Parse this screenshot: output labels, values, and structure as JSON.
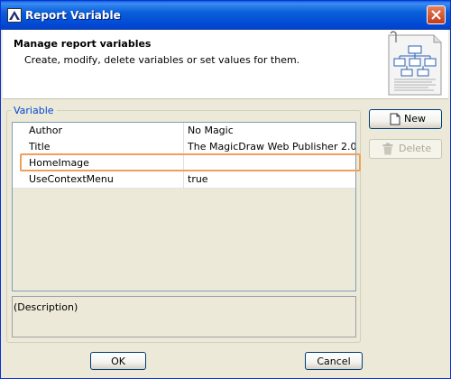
{
  "window": {
    "title": "Report Variable"
  },
  "header": {
    "title": "Manage report variables",
    "description": "Create, modify, delete variables or set values for them."
  },
  "group": {
    "label": "Variable"
  },
  "table": {
    "rows": [
      {
        "name": "Author",
        "value": "No Magic"
      },
      {
        "name": "Title",
        "value": "The MagicDraw Web Publisher 2.0"
      },
      {
        "name": "HomeImage",
        "value": ""
      },
      {
        "name": "UseContextMenu",
        "value": "true"
      }
    ]
  },
  "description_panel": {
    "text": "(Description)"
  },
  "buttons": {
    "new": "New",
    "delete": "Delete",
    "ok": "OK",
    "cancel": "Cancel"
  },
  "colors": {
    "highlight": "#f0a05a",
    "title_bar": "#0a5fd8",
    "legend": "#0046d5"
  }
}
